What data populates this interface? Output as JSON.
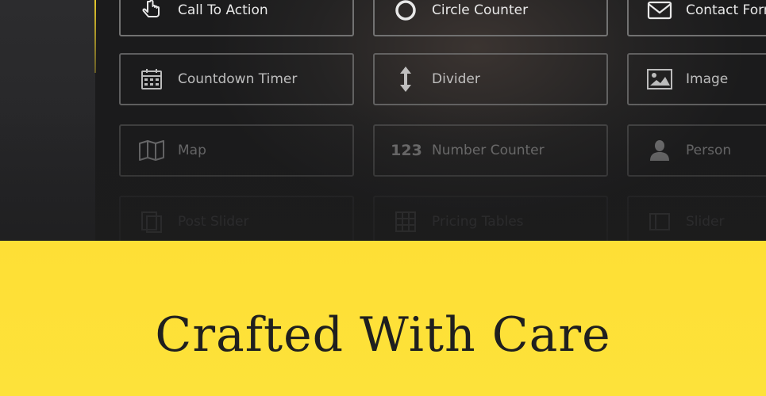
{
  "modules": [
    {
      "label": "Call To Action",
      "icon": "pointer-hand-icon"
    },
    {
      "label": "Circle Counter",
      "icon": "circle-counter-icon"
    },
    {
      "label": "Contact Form",
      "icon": "envelope-icon"
    },
    {
      "label": "Countdown Timer",
      "icon": "calendar-icon"
    },
    {
      "label": "Divider",
      "icon": "vertical-arrows-icon"
    },
    {
      "label": "Image",
      "icon": "image-icon"
    },
    {
      "label": "Map",
      "icon": "map-icon"
    },
    {
      "label": "Number Counter",
      "icon": "number-123-icon",
      "icon_text": "123"
    },
    {
      "label": "Person",
      "icon": "person-icon"
    },
    {
      "label": "Post Slider",
      "icon": "post-slider-icon"
    },
    {
      "label": "Pricing Tables",
      "icon": "pricing-table-icon"
    },
    {
      "label": "Slider",
      "icon": "slider-icon"
    }
  ],
  "headline": "Crafted With Care",
  "colors": {
    "accent_yellow": "#fedf35",
    "accent_line": "#e6c92c",
    "dark_bg": "#1c1c1d",
    "module_border": "#727272",
    "headline_text": "#1f1f1f"
  }
}
